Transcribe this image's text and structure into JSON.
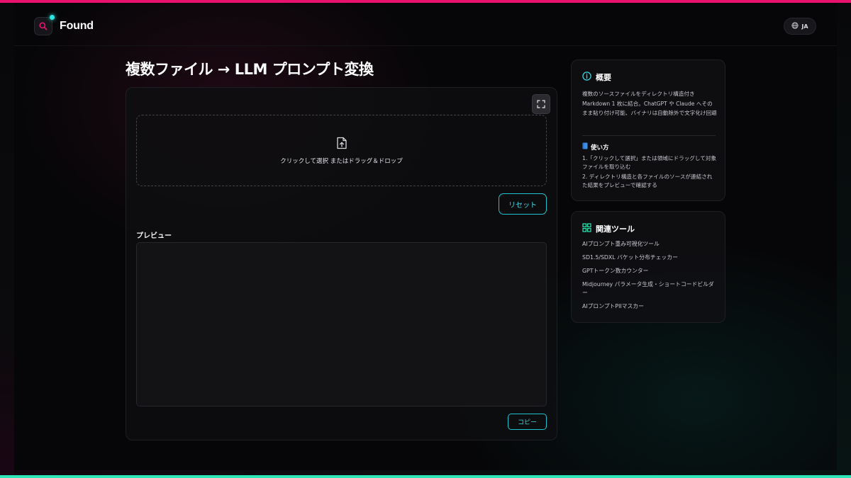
{
  "colors": {
    "accent_pink": "#e8116e",
    "accent_cyan": "#2ee6e0",
    "accent_teal": "#2ee6b8",
    "button_cyan": "#3fd8e4",
    "background": "#060608"
  },
  "header": {
    "logo_text": "Found",
    "logo_icon": "search-icon",
    "lang_label": "JA",
    "lang_icon": "globe-icon"
  },
  "main": {
    "title": "複数ファイル → LLM プロンプト変換",
    "fullscreen_icon": "fullscreen-icon",
    "dropzone": {
      "icon": "file-upload-icon",
      "text": "クリックして選択 またはドラッグ＆ドロップ"
    },
    "reset_label": "リセット",
    "preview_label": "プレビュー",
    "preview_value": "",
    "copy_label": "コピー"
  },
  "sidebar": {
    "overview": {
      "icon": "info-icon",
      "title": "概要",
      "text": "複数のソースファイルをディレクトリ構造付き Markdown 1 枚に結合。ChatGPT や Claude へそのまま貼り付け可能、バイナリは自動除外で文字化け回避",
      "usage_icon": "book-icon",
      "usage_title": "使い方",
      "usage_steps": [
        "1.「クリックして選択」または領域にドラッグして対象ファイルを取り込む",
        "2. ディレクトリ構造と各ファイルのソースが連結された結果をプレビューで確認する"
      ]
    },
    "tools": {
      "icon": "grid-icon",
      "title": "関連ツール",
      "items": [
        "AIプロンプト重み可視化ツール",
        "SD1.5/SDXL バケット分布チェッカー",
        "GPTトークン数カウンター",
        "Midjourney パラメータ生成・ショートコードビルダー",
        "AIプロンプトPIIマスカー"
      ]
    }
  }
}
